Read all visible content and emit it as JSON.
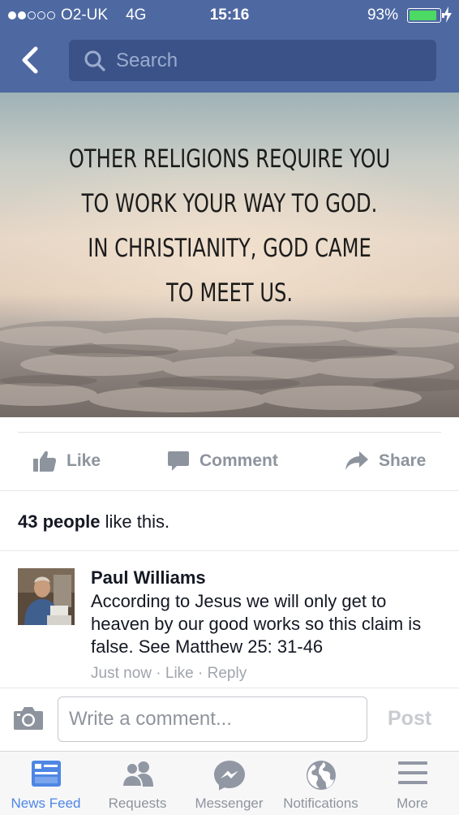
{
  "status_bar": {
    "carrier": "O2-UK",
    "network": "4G",
    "time": "15:16",
    "battery_percent": "93%",
    "battery_level": 0.93
  },
  "search": {
    "placeholder": "Search"
  },
  "post": {
    "image_quote_lines": [
      "OTHER RELIGIONS REQUIRE YOU",
      "TO WORK YOUR WAY TO GOD.",
      "IN CHRISTIANITY, GOD CAME",
      "TO MEET US."
    ],
    "actions": {
      "like": "Like",
      "comment": "Comment",
      "share": "Share"
    },
    "likes_count_text": "43 people",
    "likes_suffix": " like this."
  },
  "comment": {
    "author": "Paul Williams",
    "text": "According to Jesus we will only get to heaven by our good works so this claim is false. See Matthew 25: 31-46",
    "timestamp": "Just now",
    "separator": " · ",
    "like_label": "Like",
    "reply_label": "Reply"
  },
  "composer": {
    "placeholder": "Write a comment...",
    "post_label": "Post"
  },
  "tabs": [
    {
      "label": "News Feed",
      "icon": "news-feed-icon",
      "active": true
    },
    {
      "label": "Requests",
      "icon": "friend-requests-icon",
      "active": false
    },
    {
      "label": "Messenger",
      "icon": "messenger-icon",
      "active": false
    },
    {
      "label": "Notifications",
      "icon": "globe-icon",
      "active": false
    },
    {
      "label": "More",
      "icon": "hamburger-menu-icon",
      "active": false
    }
  ],
  "colors": {
    "header": "#4e69a2",
    "active_tab": "#4e86e4",
    "battery_fill": "#4cd964",
    "muted_text": "#8d949e"
  }
}
